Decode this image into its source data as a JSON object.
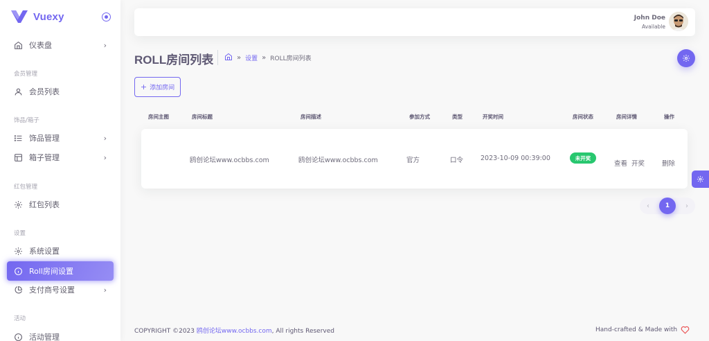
{
  "brand": {
    "name": "Vuexy"
  },
  "sidebar": {
    "dashboard": "仪表盘",
    "sections": [
      {
        "header": "会员管理",
        "items": [
          {
            "label": "会员列表"
          }
        ]
      },
      {
        "header": "饰品/箱子",
        "items": [
          {
            "label": "饰品管理"
          },
          {
            "label": "箱子管理"
          }
        ]
      },
      {
        "header": "红包管理",
        "items": [
          {
            "label": "红包列表"
          }
        ]
      },
      {
        "header": "设置",
        "items": [
          {
            "label": "系统设置"
          },
          {
            "label": "Roll房间设置"
          },
          {
            "label": "支付商号设置"
          }
        ]
      },
      {
        "header": "活动",
        "items": [
          {
            "label": "活动管理"
          }
        ]
      }
    ]
  },
  "navbar": {
    "user_name": "John Doe",
    "user_status": "Available"
  },
  "page": {
    "title": "ROLL房间列表",
    "breadcrumb": {
      "link": "设置",
      "current": "ROLL房间列表"
    },
    "add_button": "添加房间"
  },
  "table": {
    "headers": [
      "房间主图",
      "房间标题",
      "房间描述",
      "参加方式",
      "类型",
      "开奖时间",
      "房间状态",
      "房间详情",
      "操作"
    ],
    "rows": [
      {
        "image": "",
        "title": "鸥创论坛www.ocbbs.com",
        "description": "鸥创论坛www.ocbbs.com",
        "join_method": "官方",
        "type": "口令",
        "draw_time": "2023-10-09 00:39:00",
        "status": "未开奖",
        "detail_view": "查看",
        "detail_draw": "开奖",
        "action_delete": "删除"
      }
    ]
  },
  "pagination": {
    "current": "1",
    "prev": "‹",
    "next": "›"
  },
  "footer": {
    "copyright_prefix": "COPYRIGHT ©2023 ",
    "copyright_link": "鸥创论坛www.ocbbs.com",
    "copyright_suffix": ", All rights Reserved",
    "right_text": "Hand-crafted & Made with"
  },
  "colors": {
    "primary": "#7367f0",
    "success": "#28c76f",
    "text": "#6e6b7b",
    "background": "#f8f8f8"
  },
  "icons": {
    "dashboard": "home-icon",
    "members": "user-icon",
    "items": "list-icon",
    "boxes": "layout-icon",
    "redpacket": "gear-icon",
    "system": "gear-icon",
    "roll": "info-circle-icon",
    "payment": "pie-chart-icon",
    "activity": "info-circle-icon",
    "heart": "heart-icon"
  }
}
